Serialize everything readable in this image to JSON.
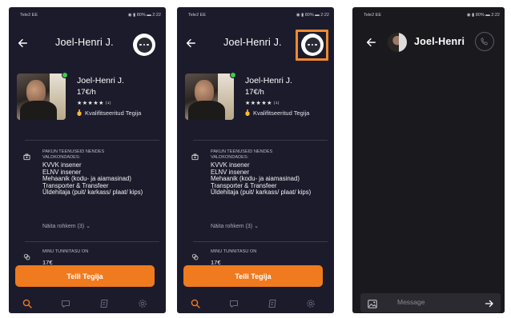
{
  "status_bar": {
    "carrier": "Tele2 EE",
    "battery": "80%",
    "time": "2:22"
  },
  "profile_screen": {
    "title": "Joel-Henri J.",
    "name": "Joel-Henri J.",
    "price": "17€/h",
    "stars": "★★★★★",
    "rating_count": "(1)",
    "qualification": "Kvalifitseeritud Tegija",
    "services_heading": "PAKUN TEENUSEID NENDES VALDKONDADES:",
    "services": [
      "KVVK insener",
      "ELNV insener",
      "Mehaanik (kodu- ja aiamasinad)",
      "Transporter & Transfeer",
      "Üldehitaja (puit/ karkass/ plaat/ kips)"
    ],
    "show_more": "Näita rohkem (3)",
    "rate_heading": "MINU TUNNITASU ON",
    "rate_value": "17€",
    "cta_label": "Telli Tegija",
    "tabs": [
      "search-icon",
      "chat-icon",
      "orders-icon",
      "settings-icon"
    ]
  },
  "chat_screen": {
    "title": "Joel-Henri",
    "message_placeholder": "Message"
  },
  "colors": {
    "background": "#1c1b2b",
    "accent": "#f07a1e",
    "highlight": "#f08a2e",
    "online": "#3ccf4e"
  }
}
